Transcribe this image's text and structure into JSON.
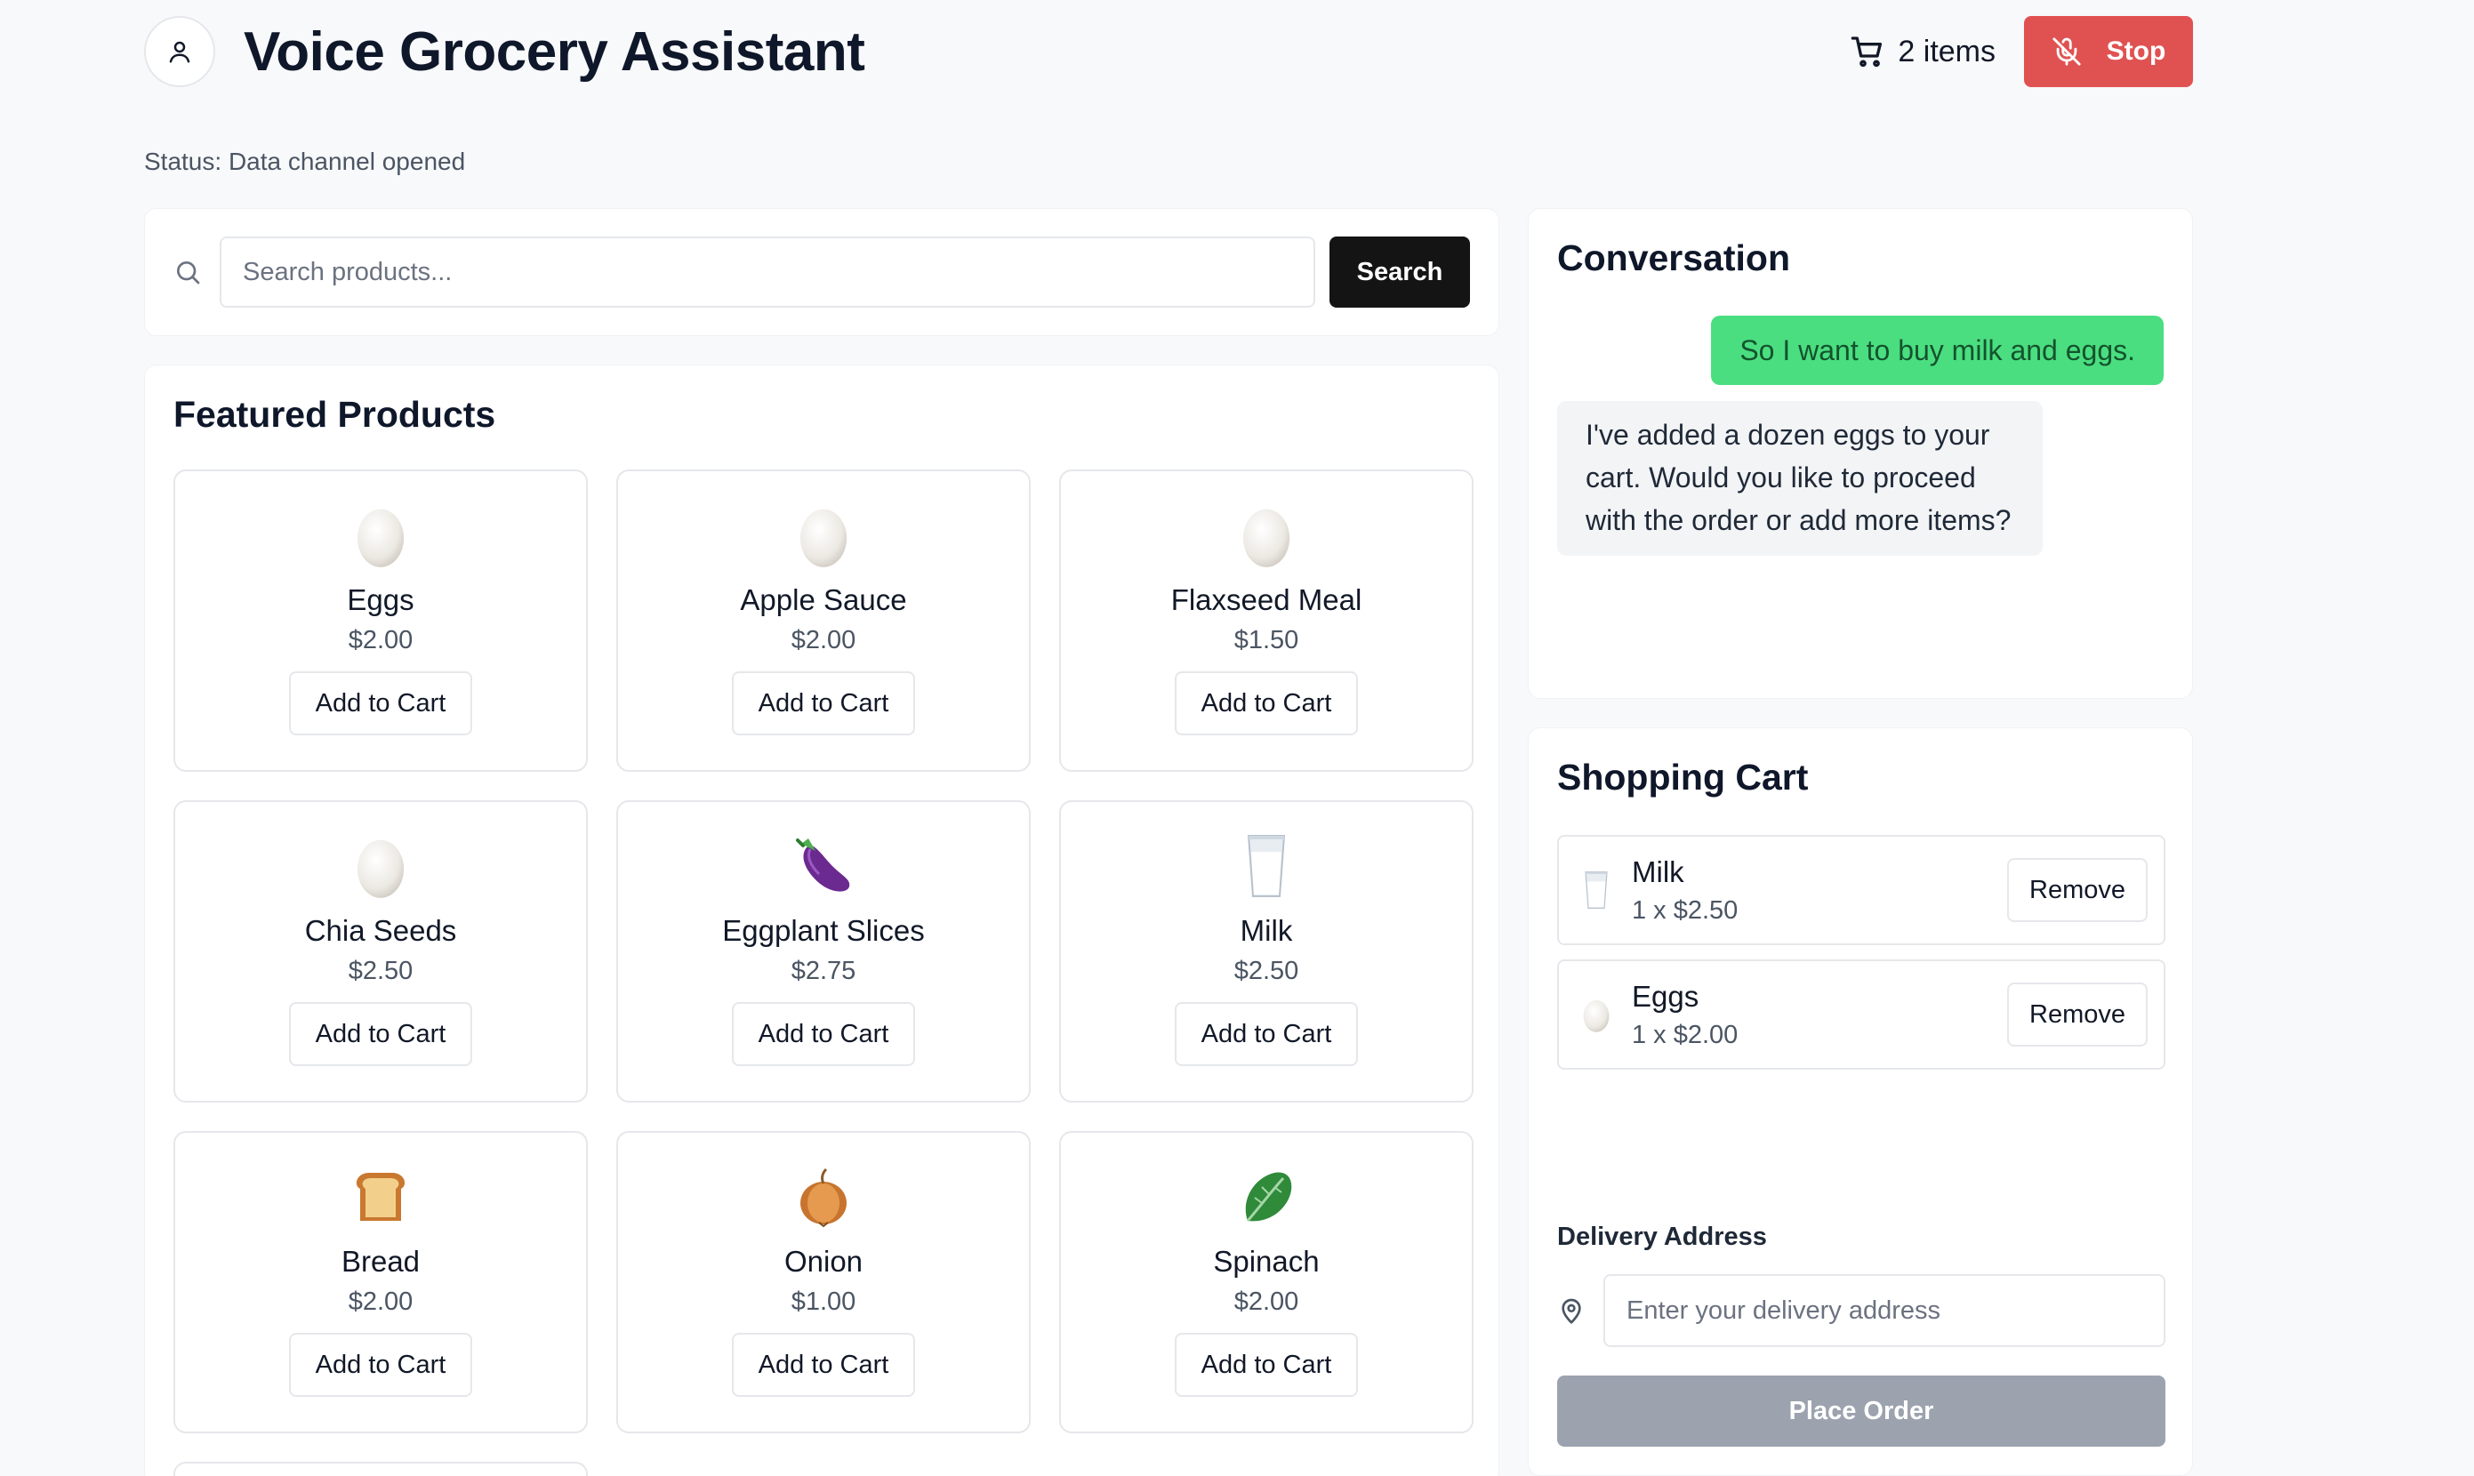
{
  "header": {
    "title": "Voice Grocery Assistant",
    "cart_count_label": "2 items",
    "stop_label": "Stop"
  },
  "status": "Status: Data channel opened",
  "search": {
    "placeholder": "Search products...",
    "value": "",
    "button_label": "Search"
  },
  "products": {
    "title": "Featured Products",
    "add_label": "Add to Cart",
    "items": [
      {
        "name": "Eggs",
        "price": "$2.00",
        "icon": "egg-icon"
      },
      {
        "name": "Apple Sauce",
        "price": "$2.00",
        "icon": "egg-icon"
      },
      {
        "name": "Flaxseed Meal",
        "price": "$1.50",
        "icon": "egg-icon"
      },
      {
        "name": "Chia Seeds",
        "price": "$2.50",
        "icon": "egg-icon"
      },
      {
        "name": "Eggplant Slices",
        "price": "$2.75",
        "icon": "eggplant-icon"
      },
      {
        "name": "Milk",
        "price": "$2.50",
        "icon": "milk-glass-icon"
      },
      {
        "name": "Bread",
        "price": "$2.00",
        "icon": "bread-icon"
      },
      {
        "name": "Onion",
        "price": "$1.00",
        "icon": "onion-icon"
      },
      {
        "name": "Spinach",
        "price": "$2.00",
        "icon": "leafy-green-icon"
      }
    ]
  },
  "conversation": {
    "title": "Conversation",
    "messages": [
      {
        "role": "user",
        "text": "So I want to buy milk and eggs."
      },
      {
        "role": "assistant",
        "text": "I've added a dozen eggs to your cart. Would you like to proceed with the order or add more items?"
      }
    ]
  },
  "cart": {
    "title": "Shopping Cart",
    "remove_label": "Remove",
    "items": [
      {
        "name": "Milk",
        "qty": "1 x $2.50",
        "icon": "milk-glass-icon"
      },
      {
        "name": "Eggs",
        "qty": "1 x $2.00",
        "icon": "egg-icon"
      }
    ],
    "address_label": "Delivery Address",
    "address_placeholder": "Enter your delivery address",
    "address_value": "",
    "place_order_label": "Place Order"
  },
  "colors": {
    "stop": "#e05252",
    "user_bubble": "#4ade80",
    "assistant_bubble": "#f3f4f6",
    "search_button": "#141414",
    "place_order_disabled": "#9ca3af"
  }
}
